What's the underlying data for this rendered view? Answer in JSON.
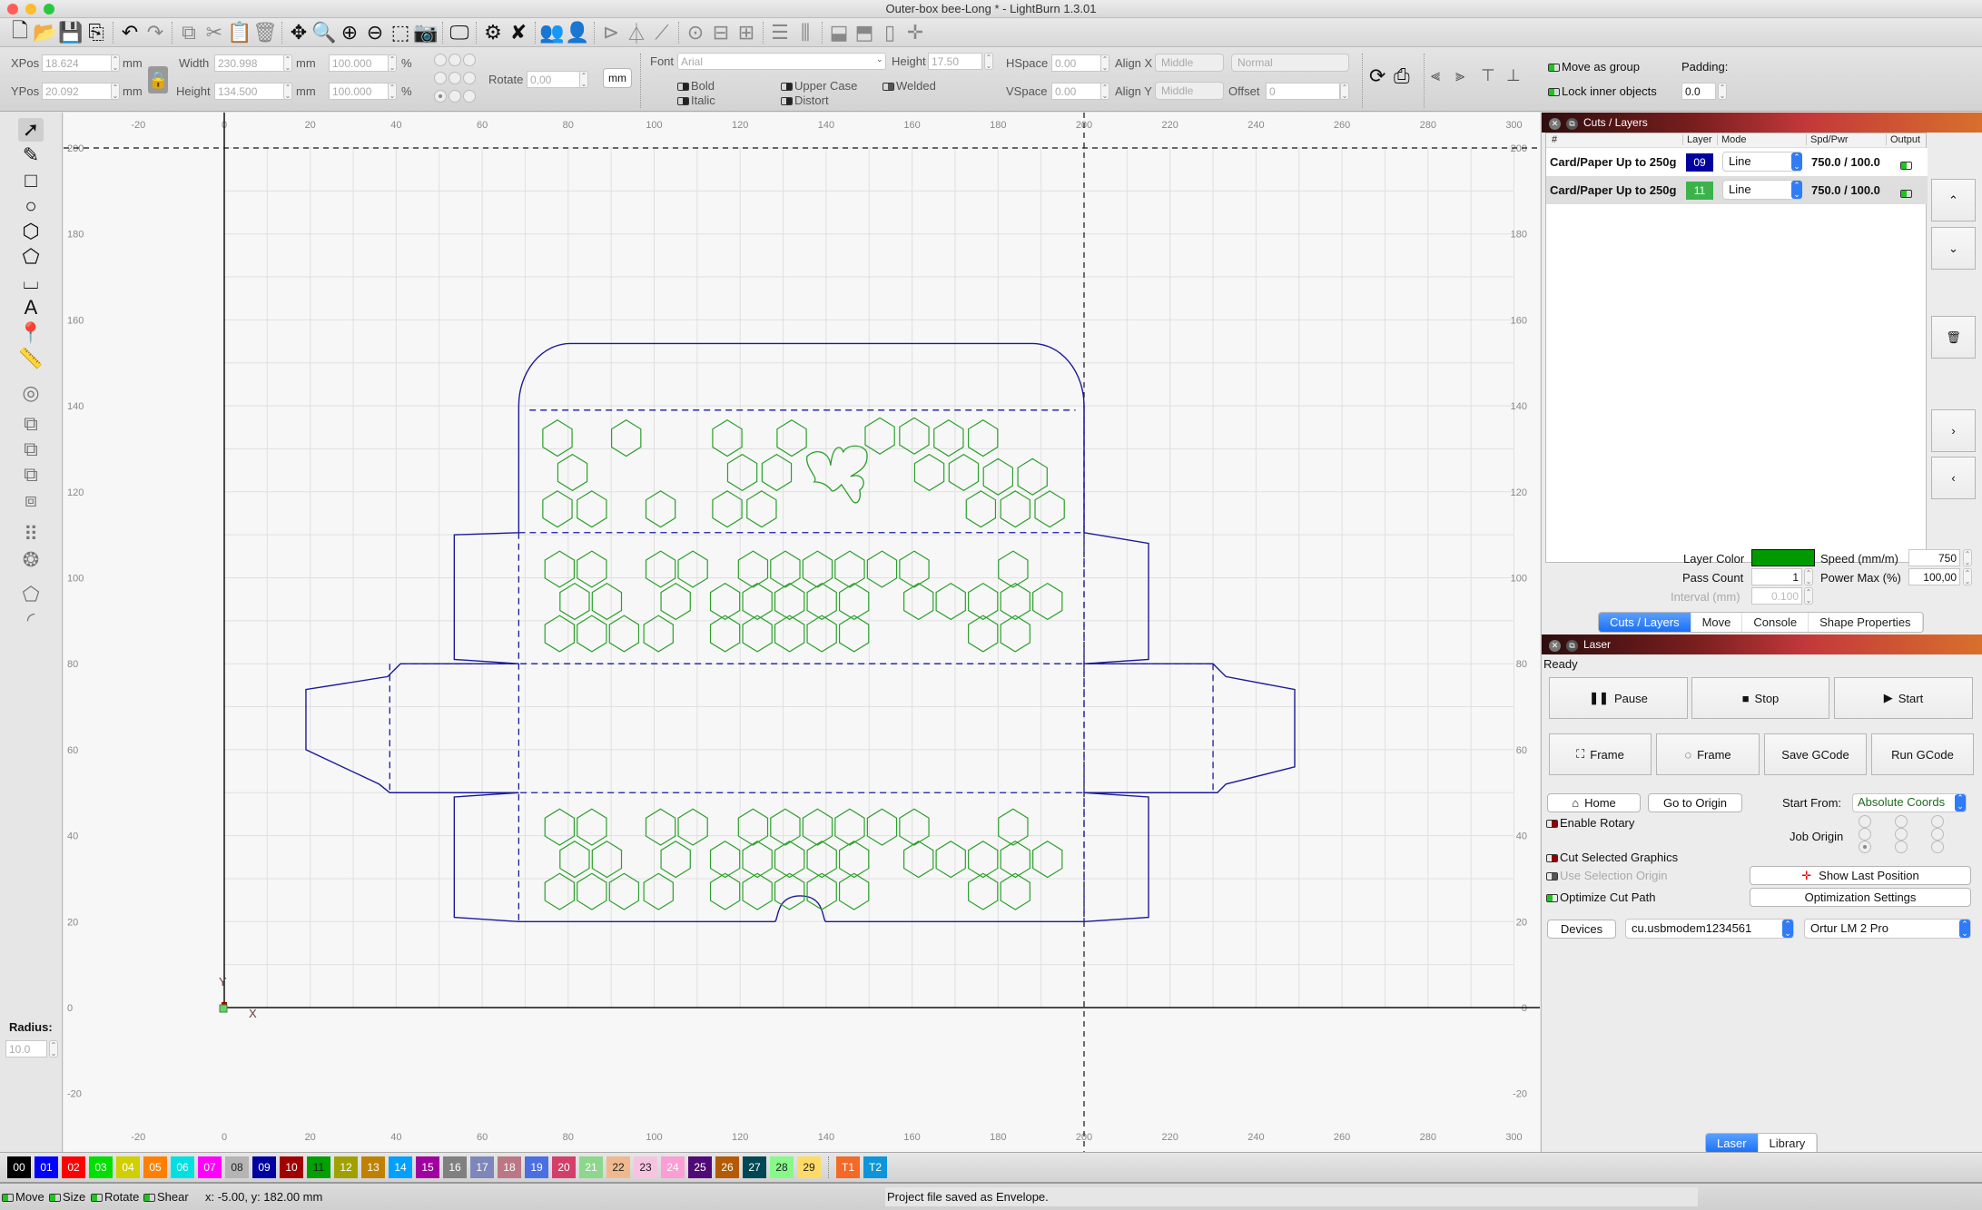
{
  "window": {
    "title": "Outer-box bee-Long * - LightBurn 1.3.01",
    "traffic_lights": [
      "#fe5f57",
      "#febc2e",
      "#28c840"
    ]
  },
  "toolbar": {
    "icons": [
      {
        "name": "new-file-icon",
        "glyph": "🗋"
      },
      {
        "name": "open-folder-icon",
        "glyph": "📂"
      },
      {
        "name": "save-icon",
        "glyph": "💾"
      },
      {
        "name": "import-icon",
        "glyph": "⎘"
      },
      {
        "sep": true
      },
      {
        "name": "undo-icon",
        "glyph": "↶"
      },
      {
        "name": "redo-icon",
        "glyph": "↷",
        "dim": true
      },
      {
        "sep": true
      },
      {
        "name": "copy-icon",
        "glyph": "⧉",
        "dim": true
      },
      {
        "name": "cut-icon",
        "glyph": "✂",
        "dim": true
      },
      {
        "name": "paste-icon",
        "glyph": "📋"
      },
      {
        "name": "delete-icon",
        "glyph": "🗑",
        "dim": true
      },
      {
        "sep": true
      },
      {
        "name": "move-icon",
        "glyph": "✥"
      },
      {
        "name": "zoom-page-icon",
        "glyph": "🔍"
      },
      {
        "name": "zoom-in-icon",
        "glyph": "⊕"
      },
      {
        "name": "zoom-out-icon",
        "glyph": "⊖"
      },
      {
        "name": "zoom-selection-icon",
        "glyph": "⬚"
      },
      {
        "name": "camera-icon",
        "glyph": "📷",
        "dim": true
      },
      {
        "sep": true
      },
      {
        "name": "monitor-icon",
        "glyph": "🖵"
      },
      {
        "sep": true
      },
      {
        "name": "settings-icon",
        "glyph": "⚙"
      },
      {
        "name": "machine-settings-icon",
        "glyph": "✘"
      },
      {
        "sep": true
      },
      {
        "name": "group-icon",
        "glyph": "👥",
        "dim": true
      },
      {
        "name": "ungroup-icon",
        "glyph": "👤",
        "dim": true
      },
      {
        "sep": true
      },
      {
        "name": "flip-vertical-icon",
        "glyph": "⊳",
        "dim": true
      },
      {
        "name": "flip-horizontal-icon",
        "glyph": "⏃",
        "dim": true
      },
      {
        "name": "mirror-across-line-icon",
        "glyph": "⟋",
        "dim": true
      },
      {
        "sep": true
      },
      {
        "name": "align-centers-icon",
        "glyph": "⊙",
        "dim": true
      },
      {
        "name": "align-h-center-icon",
        "glyph": "⊟",
        "dim": true
      },
      {
        "name": "align-v-center-icon",
        "glyph": "⊞",
        "dim": true
      },
      {
        "sep": true
      },
      {
        "name": "distribute-h-icon",
        "glyph": "☰",
        "dim": true
      },
      {
        "name": "distribute-v-icon",
        "glyph": "⫼",
        "dim": true
      },
      {
        "sep": true
      },
      {
        "name": "make-same-width-icon",
        "glyph": "⬓",
        "dim": true
      },
      {
        "name": "make-same-height-icon",
        "glyph": "⬒",
        "dim": true
      },
      {
        "name": "move-together-icon",
        "glyph": "▯",
        "dim": true
      },
      {
        "name": "nudge-icon",
        "glyph": "✛",
        "dim": true
      }
    ]
  },
  "props": {
    "xpos_label": "XPos",
    "xpos": "18.624",
    "ypos_label": "YPos",
    "ypos": "20.092",
    "unit": "mm",
    "width_label": "Width",
    "width": "230.998",
    "height_label": "Height",
    "height": "134.500",
    "scale_w": "100.000",
    "scale_h": "100.000",
    "pct": "%",
    "rotate_label": "Rotate",
    "rotate": "0,00",
    "mm_button": "mm",
    "font_label": "Font",
    "font": "Arial",
    "text_height_label": "Height",
    "text_height": "17.50",
    "hspace_label": "HSpace",
    "hspace": "0.00",
    "vspace_label": "VSpace",
    "vspace": "0.00",
    "alignx_label": "Align X",
    "alignx": "Middle",
    "aligny_label": "Align Y",
    "aligny": "Middle",
    "text_mode": "Normal",
    "offset_label": "Offset",
    "offset": "0",
    "bold": "Bold",
    "italic": "Italic",
    "upper_case": "Upper Case",
    "distort": "Distort",
    "welded": "Welded",
    "move_as_group": "Move as group",
    "lock_inner": "Lock inner objects",
    "padding_label": "Padding:",
    "padding": "0.0"
  },
  "left_tools": {
    "items": [
      {
        "name": "select-tool-icon",
        "glyph": "➚"
      },
      {
        "name": "edit-nodes-tool-icon",
        "glyph": "✎"
      },
      {
        "name": "rectangle-tool-icon",
        "glyph": "□"
      },
      {
        "name": "ellipse-tool-icon",
        "glyph": "○"
      },
      {
        "name": "polygon-tool-icon",
        "glyph": "⬡"
      },
      {
        "name": "draw-lines-tool-icon",
        "glyph": "⬠"
      },
      {
        "name": "tabs-tool-icon",
        "glyph": "⌴"
      },
      {
        "name": "text-tool-icon",
        "glyph": "A"
      },
      {
        "name": "position-laser-icon",
        "glyph": "📍"
      },
      {
        "name": "measure-tool-icon",
        "glyph": "📏"
      },
      {
        "name": "offset-shapes-icon",
        "glyph": "◎",
        "dim": true
      },
      {
        "name": "weld-icon",
        "glyph": "⧉",
        "dim": true
      },
      {
        "name": "boolean-union-icon",
        "glyph": "⧉",
        "dim": true
      },
      {
        "name": "boolean-subtract-icon",
        "glyph": "⧉",
        "dim": true
      },
      {
        "name": "boolean-intersect-icon",
        "glyph": "⧈",
        "dim": true
      },
      {
        "name": "grid-array-icon",
        "glyph": "⠿",
        "dim": true
      },
      {
        "name": "circular-array-icon",
        "glyph": "❂",
        "dim": true
      },
      {
        "name": "convert-to-path-icon",
        "glyph": "⬠",
        "dim": true
      },
      {
        "name": "corner-radius-icon",
        "glyph": "◜",
        "dim": true
      }
    ],
    "radius_label": "Radius:",
    "radius": "10.0"
  },
  "canvas": {
    "x_ticks": [
      -20,
      0,
      20,
      40,
      60,
      80,
      100,
      120,
      140,
      160,
      180,
      200,
      220,
      240,
      260,
      280,
      300
    ],
    "y_ticks": [
      -20,
      0,
      20,
      40,
      60,
      80,
      100,
      120,
      140,
      160,
      180,
      200
    ],
    "bed_width_mm": 300,
    "bed_height_mm": 200,
    "axis_x_label": "X",
    "axis_y_label": "Y",
    "cut_color": "#1a1a9c",
    "engrave_color": "#2aa02a"
  },
  "palette": {
    "swatches": [
      {
        "label": "00",
        "color": "#000000"
      },
      {
        "label": "01",
        "color": "#0000ff"
      },
      {
        "label": "02",
        "color": "#ff0000"
      },
      {
        "label": "03",
        "color": "#00e000"
      },
      {
        "label": "04",
        "color": "#d0d000"
      },
      {
        "label": "05",
        "color": "#ff8000"
      },
      {
        "label": "06",
        "color": "#00e0e0"
      },
      {
        "label": "07",
        "color": "#ff00ff"
      },
      {
        "label": "08",
        "color": "#b4b4b4"
      },
      {
        "label": "09",
        "color": "#0000a0"
      },
      {
        "label": "10",
        "color": "#a00000"
      },
      {
        "label": "11",
        "color": "#00a000"
      },
      {
        "label": "12",
        "color": "#a0a000"
      },
      {
        "label": "13",
        "color": "#c08000"
      },
      {
        "label": "14",
        "color": "#00a0ff"
      },
      {
        "label": "15",
        "color": "#a000a0"
      },
      {
        "label": "16",
        "color": "#808080"
      },
      {
        "label": "17",
        "color": "#7d87b9"
      },
      {
        "label": "18",
        "color": "#bb7784"
      },
      {
        "label": "19",
        "color": "#4a6fe3"
      },
      {
        "label": "20",
        "color": "#d33f6a"
      },
      {
        "label": "21",
        "color": "#8cd78c"
      },
      {
        "label": "22",
        "color": "#f0b98d"
      },
      {
        "label": "23",
        "color": "#f6c4e1"
      },
      {
        "label": "24",
        "color": "#fa9ed4"
      },
      {
        "label": "25",
        "color": "#500a78"
      },
      {
        "label": "26",
        "color": "#b45a00"
      },
      {
        "label": "27",
        "color": "#004754"
      },
      {
        "label": "28",
        "color": "#86fa88"
      },
      {
        "label": "29",
        "color": "#ffdb66"
      },
      {
        "label": "T1",
        "color": "#f36926",
        "tool": true
      },
      {
        "label": "T2",
        "color": "#0c96d9",
        "tool": true
      }
    ]
  },
  "status": {
    "move": "Move",
    "size": "Size",
    "rotate": "Rotate",
    "shear": "Shear",
    "coords": "x: -5.00, y: 182.00 mm",
    "message": "Project file saved as Envelope."
  },
  "cuts": {
    "title": "Cuts / Layers",
    "headers": [
      "#",
      "Layer",
      "Mode",
      "Spd/Pwr",
      "Output"
    ],
    "rows": [
      {
        "name": "Card/Paper Up to 250g",
        "layer": "09",
        "color": "#0000a0",
        "mode": "Line",
        "spdpwr": "750.0 / 100.0",
        "output": true
      },
      {
        "name": "Card/Paper Up to 250g",
        "layer": "11",
        "color": "#3cb34a",
        "mode": "Line",
        "spdpwr": "750.0 / 100.0",
        "output": true
      }
    ],
    "layer_color_label": "Layer Color",
    "layer_color": "#009900",
    "pass_count_label": "Pass Count",
    "pass_count": "1",
    "interval_label": "Interval (mm)",
    "interval": "0.100",
    "speed_label": "Speed (mm/m)",
    "speed": "750",
    "power_label": "Power Max (%)",
    "power": "100,00",
    "tabs": [
      "Cuts / Layers",
      "Move",
      "Console",
      "Shape Properties"
    ],
    "active_tab": 0
  },
  "laser": {
    "title": "Laser",
    "status": "Ready",
    "pause": "Pause",
    "stop": "Stop",
    "start": "Start",
    "frame_rect": "Frame",
    "frame_circle": "Frame",
    "save_gcode": "Save GCode",
    "run_gcode": "Run GCode",
    "home": "Home",
    "go_to_origin": "Go to Origin",
    "start_from_label": "Start From:",
    "start_from": "Absolute Coords",
    "enable_rotary": "Enable Rotary",
    "job_origin_label": "Job Origin",
    "cut_selected": "Cut Selected Graphics",
    "use_selection_origin": "Use Selection Origin",
    "optimize_cut_path": "Optimize Cut Path",
    "show_last_position": "Show Last Position",
    "optimization_settings": "Optimization Settings",
    "devices": "Devices",
    "port": "cu.usbmodem1234561",
    "device": "Ortur LM 2 Pro",
    "bottom_tabs": [
      "Laser",
      "Library"
    ],
    "active_bottom_tab": 0
  }
}
